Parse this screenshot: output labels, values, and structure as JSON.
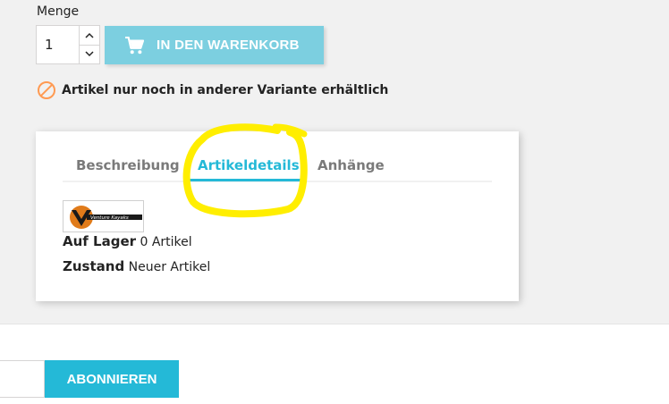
{
  "product": {
    "quantity_label": "Menge",
    "quantity_value": "1",
    "add_to_cart_label": "IN DEN WARENKORB",
    "availability_message": "Artikel nur noch in anderer Variante erhältlich"
  },
  "tabs": [
    {
      "label": "Beschreibung",
      "active": false
    },
    {
      "label": "Artikeldetails",
      "active": true
    },
    {
      "label": "Anhänge",
      "active": false
    }
  ],
  "details": {
    "brand_logo_text": "Venture Kayaks",
    "stock_label": "Auf Lager",
    "stock_value": "0 Artikel",
    "condition_label": "Zustand",
    "condition_value": "Neuer Artikel"
  },
  "newsletter": {
    "subscribe_label": "ABONNIEREN"
  },
  "colors": {
    "accent": "#24b9d7",
    "cart_button": "#7ccfe0",
    "warning": "#ff9a52",
    "highlight": "#ffee00"
  },
  "icons": {
    "cart": "shopping-cart-icon",
    "unavailable": "block-icon",
    "spin_up": "chevron-up-icon",
    "spin_down": "chevron-down-icon"
  }
}
